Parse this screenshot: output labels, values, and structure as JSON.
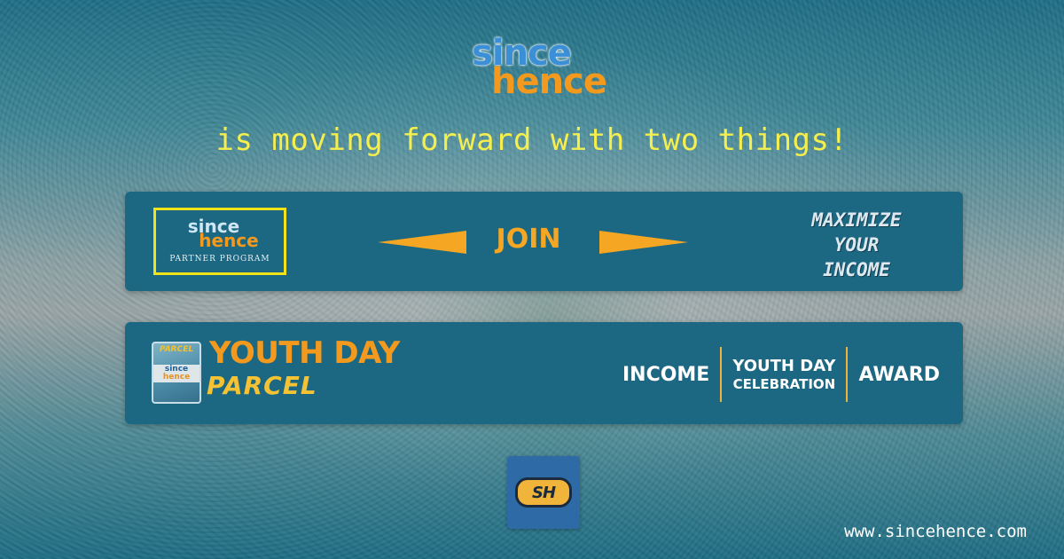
{
  "logo": {
    "since": "since",
    "hence": "hence"
  },
  "tagline": "is moving forward with two things!",
  "partner": {
    "since": "since",
    "hence": "hence",
    "program": "PARTNER PROGRAM",
    "join": "JOIN",
    "maximize": [
      "MAXIMIZE",
      "YOUR",
      "INCOME"
    ]
  },
  "youth": {
    "icon_top": "PARCEL",
    "icon_since": "since",
    "icon_hence": "hence",
    "title": "YOUTH DAY",
    "subtitle": "PARCEL",
    "income": "INCOME",
    "celebration_line1": "YOUTH DAY",
    "celebration_line2": "CELEBRATION",
    "award": "AWARD"
  },
  "sh_logo": "SH",
  "url": "www.sincehence.com",
  "colors": {
    "banner": "#1c6883",
    "accent_orange": "#f39a1e",
    "accent_yellow": "#f4ee4e",
    "brand_blue": "#3a8fd6"
  }
}
